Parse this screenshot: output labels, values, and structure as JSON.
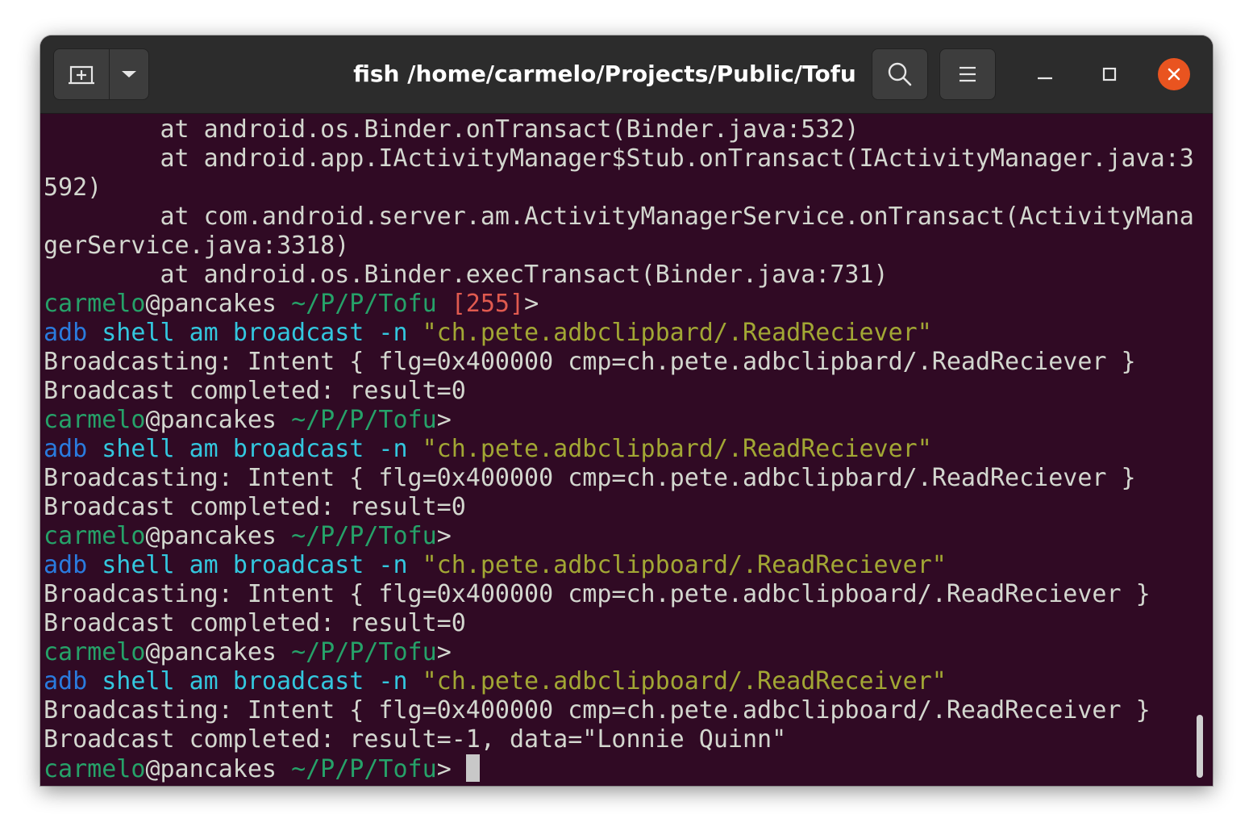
{
  "window": {
    "title": "fish /home/carmelo/Projects/Public/Tofu"
  },
  "toolbar": {
    "new_tab_icon": "new-tab-icon",
    "menu_dropdown_icon": "chevron-down-icon",
    "search_icon": "search-icon",
    "menu_icon": "hamburger-menu-icon",
    "minimize_icon": "minimize-icon",
    "maximize_icon": "maximize-icon",
    "close_icon": "close-icon"
  },
  "colors": {
    "terminal_bg": "#300a24",
    "titlebar_bg": "#2c2c2c",
    "close_button": "#e95420",
    "prompt_green": "#26a269",
    "error_red": "#e05a4f",
    "command_blue": "#2a7bde",
    "argument_cyan": "#33c7de",
    "string_yellow": "#a2a734",
    "default_text": "#d3d7cf"
  },
  "terminal": {
    "lines": [
      [
        {
          "t": "        at android.os.Binder.onTransact(Binder.java:532)",
          "c": "default"
        }
      ],
      [
        {
          "t": "        at android.app.IActivityManager$Stub.onTransact(IActivityManager.java:3",
          "c": "default"
        }
      ],
      [
        {
          "t": "592)",
          "c": "default"
        }
      ],
      [
        {
          "t": "        at com.android.server.am.ActivityManagerService.onTransact(ActivityMana",
          "c": "default"
        }
      ],
      [
        {
          "t": "gerService.java:3318)",
          "c": "default"
        }
      ],
      [
        {
          "t": "        at android.os.Binder.execTransact(Binder.java:731)",
          "c": "default"
        }
      ],
      [
        {
          "t": "carmelo",
          "c": "green"
        },
        {
          "t": "@pancakes ",
          "c": "default"
        },
        {
          "t": "~/P/P/Tofu",
          "c": "green"
        },
        {
          "t": " ",
          "c": "default"
        },
        {
          "t": "[255]",
          "c": "red"
        },
        {
          "t": ">",
          "c": "default"
        }
      ],
      [
        {
          "t": "adb",
          "c": "blue"
        },
        {
          "t": " ",
          "c": "default"
        },
        {
          "t": "shell am",
          "c": "cyan"
        },
        {
          "t": " ",
          "c": "default"
        },
        {
          "t": "broadcast -n",
          "c": "cyan"
        },
        {
          "t": " ",
          "c": "default"
        },
        {
          "t": "\"ch.pete.adbclipbard/.ReadReciever\"",
          "c": "yellow"
        }
      ],
      [
        {
          "t": "Broadcasting: Intent { flg=0x400000 cmp=ch.pete.adbclipbard/.ReadReciever }",
          "c": "default"
        }
      ],
      [
        {
          "t": "Broadcast completed: result=0",
          "c": "default"
        }
      ],
      [
        {
          "t": "carmelo",
          "c": "green"
        },
        {
          "t": "@pancakes ",
          "c": "default"
        },
        {
          "t": "~/P/P/Tofu",
          "c": "green"
        },
        {
          "t": ">",
          "c": "default"
        }
      ],
      [
        {
          "t": "adb",
          "c": "blue"
        },
        {
          "t": " ",
          "c": "default"
        },
        {
          "t": "shell am",
          "c": "cyan"
        },
        {
          "t": " ",
          "c": "default"
        },
        {
          "t": "broadcast -n",
          "c": "cyan"
        },
        {
          "t": " ",
          "c": "default"
        },
        {
          "t": "\"ch.pete.adbclipbard/.ReadReciever\"",
          "c": "yellow"
        }
      ],
      [
        {
          "t": "Broadcasting: Intent { flg=0x400000 cmp=ch.pete.adbclipbard/.ReadReciever }",
          "c": "default"
        }
      ],
      [
        {
          "t": "Broadcast completed: result=0",
          "c": "default"
        }
      ],
      [
        {
          "t": "carmelo",
          "c": "green"
        },
        {
          "t": "@pancakes ",
          "c": "default"
        },
        {
          "t": "~/P/P/Tofu",
          "c": "green"
        },
        {
          "t": ">",
          "c": "default"
        }
      ],
      [
        {
          "t": "adb",
          "c": "blue"
        },
        {
          "t": " ",
          "c": "default"
        },
        {
          "t": "shell am",
          "c": "cyan"
        },
        {
          "t": " ",
          "c": "default"
        },
        {
          "t": "broadcast -n",
          "c": "cyan"
        },
        {
          "t": " ",
          "c": "default"
        },
        {
          "t": "\"ch.pete.adbclipboard/.ReadReciever\"",
          "c": "yellow"
        }
      ],
      [
        {
          "t": "Broadcasting: Intent { flg=0x400000 cmp=ch.pete.adbclipboard/.ReadReciever }",
          "c": "default"
        }
      ],
      [
        {
          "t": "Broadcast completed: result=0",
          "c": "default"
        }
      ],
      [
        {
          "t": "carmelo",
          "c": "green"
        },
        {
          "t": "@pancakes ",
          "c": "default"
        },
        {
          "t": "~/P/P/Tofu",
          "c": "green"
        },
        {
          "t": ">",
          "c": "default"
        }
      ],
      [
        {
          "t": "adb",
          "c": "blue"
        },
        {
          "t": " ",
          "c": "default"
        },
        {
          "t": "shell am",
          "c": "cyan"
        },
        {
          "t": " ",
          "c": "default"
        },
        {
          "t": "broadcast -n",
          "c": "cyan"
        },
        {
          "t": " ",
          "c": "default"
        },
        {
          "t": "\"ch.pete.adbclipboard/.ReadReceiver\"",
          "c": "yellow"
        }
      ],
      [
        {
          "t": "Broadcasting: Intent { flg=0x400000 cmp=ch.pete.adbclipboard/.ReadReceiver }",
          "c": "default"
        }
      ],
      [
        {
          "t": "Broadcast completed: result=-1, data=\"Lonnie Quinn\"",
          "c": "default"
        }
      ],
      [
        {
          "t": "carmelo",
          "c": "green"
        },
        {
          "t": "@pancakes ",
          "c": "default"
        },
        {
          "t": "~/P/P/Tofu",
          "c": "green"
        },
        {
          "t": "> ",
          "c": "default"
        }
      ]
    ]
  }
}
